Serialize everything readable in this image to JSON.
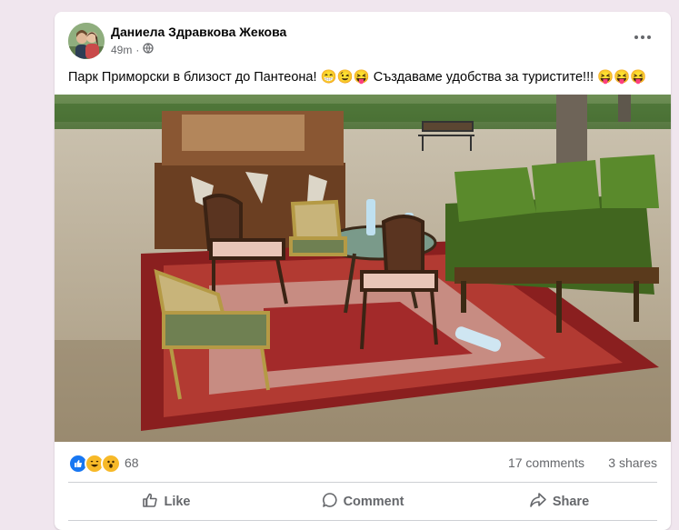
{
  "post": {
    "author": "Даниела Здравкова Жекова",
    "time": "49m",
    "separator": "·",
    "privacy_icon": "globe-icon",
    "text": "Парк Приморски в близост до Пантеона! 😁😉😝 Създаваме удобства за туристите!!! 😝😝😝",
    "photo_alt": "Park furniture"
  },
  "reactions": {
    "icons": [
      "like-icon",
      "haha-icon",
      "wow-icon"
    ],
    "count": "68",
    "comments": "17 comments",
    "shares": "3 shares"
  },
  "actions": {
    "like": "Like",
    "comment": "Comment",
    "share": "Share"
  },
  "colors": {
    "like_blue": "#1877f2",
    "reaction_yellow": "#f7b928",
    "muted": "#65676b"
  }
}
